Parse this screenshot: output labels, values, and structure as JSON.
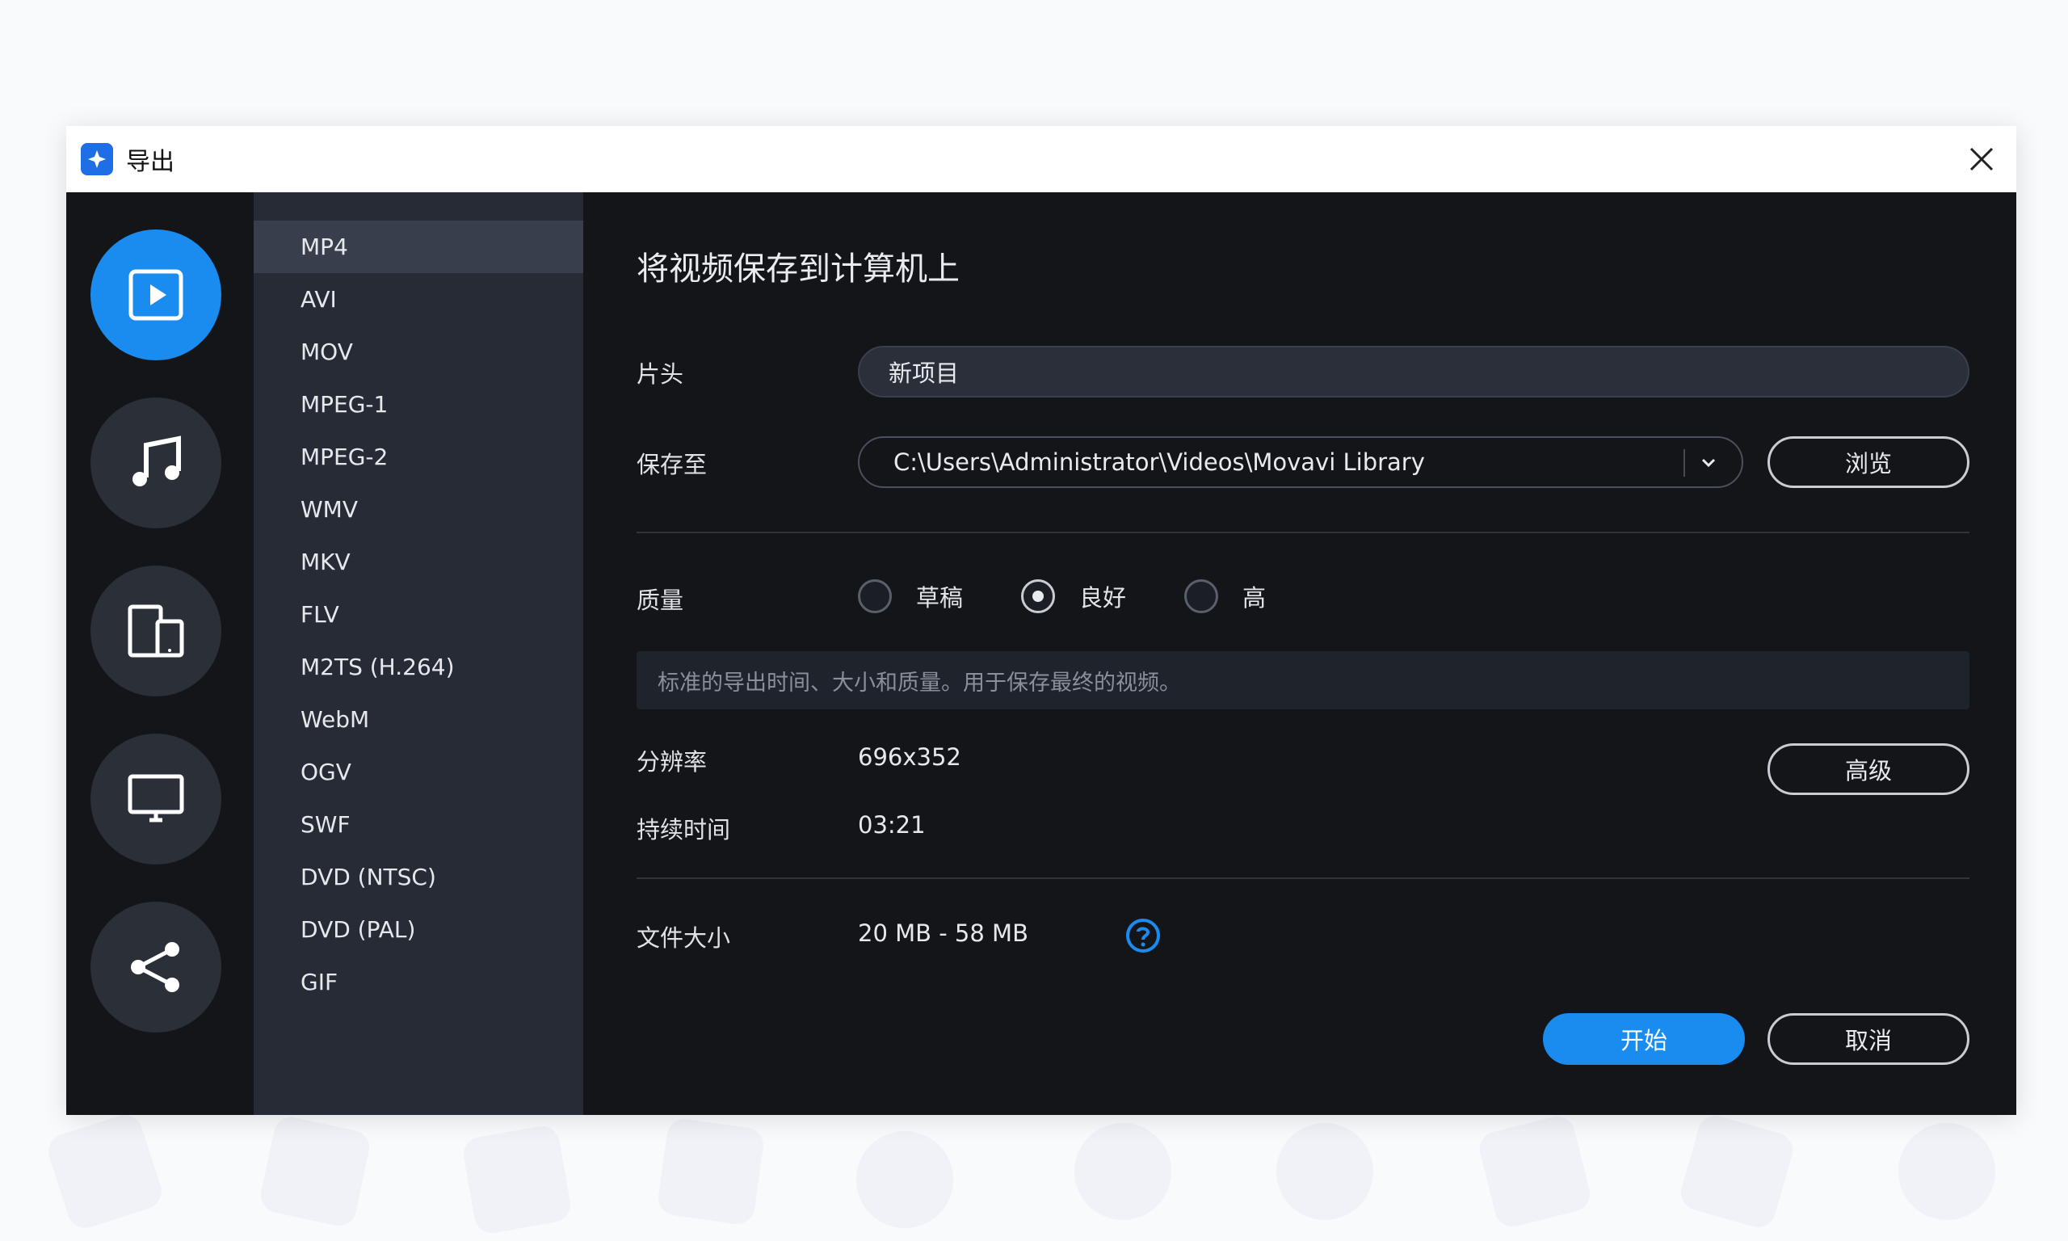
{
  "window": {
    "title": "导出",
    "close_label": "×"
  },
  "rail": {
    "items": [
      {
        "name": "video",
        "active": true
      },
      {
        "name": "audio",
        "active": false
      },
      {
        "name": "devices",
        "active": false
      },
      {
        "name": "tv",
        "active": false
      },
      {
        "name": "share",
        "active": false
      }
    ]
  },
  "formats": [
    "MP4",
    "AVI",
    "MOV",
    "MPEG-1",
    "MPEG-2",
    "WMV",
    "MKV",
    "FLV",
    "M2TS (H.264)",
    "WebM",
    "OGV",
    "SWF",
    "DVD (NTSC)",
    "DVD (PAL)",
    "GIF"
  ],
  "selected_format": "MP4",
  "main": {
    "heading": "将视频保存到计算机上",
    "title_label": "片头",
    "title_value": "新项目",
    "save_label": "保存至",
    "save_path": "C:\\Users\\Administrator\\Videos\\Movavi Library",
    "browse_label": "浏览",
    "quality_label": "质量",
    "quality_options": [
      "草稿",
      "良好",
      "高"
    ],
    "quality_selected": "良好",
    "quality_description": "标准的导出时间、大小和质量。用于保存最终的视频。",
    "resolution_label": "分辨率",
    "resolution_value": "696x352",
    "advanced_label": "高级",
    "duration_label": "持续时间",
    "duration_value": "03:21",
    "filesize_label": "文件大小",
    "filesize_value": "20 MB - 58 MB",
    "start_label": "开始",
    "cancel_label": "取消"
  },
  "colors": {
    "accent": "#1a8cf0",
    "panel": "#262b36",
    "bg": "#131519"
  }
}
